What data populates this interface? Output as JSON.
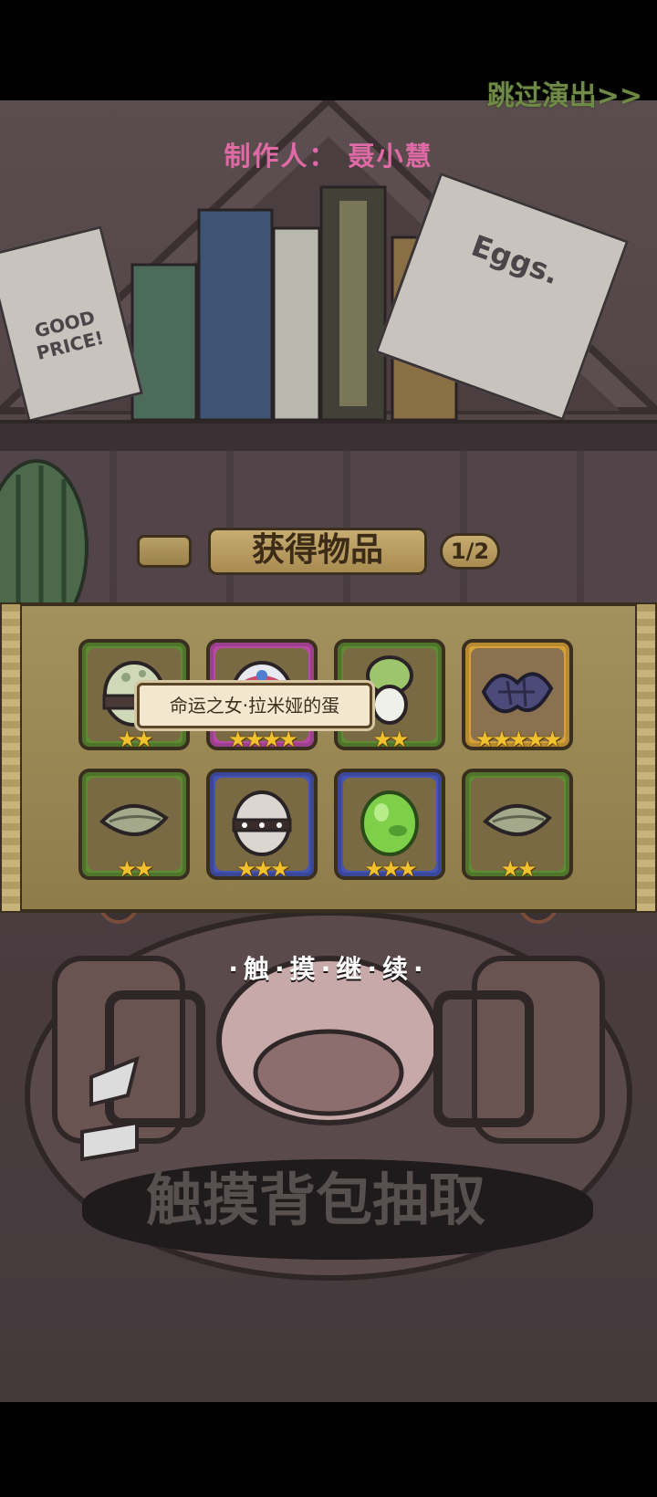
{
  "header": {
    "skip_label": "跳过演出>>",
    "credit": "制作人：  聂小慧"
  },
  "result_panel": {
    "title": "获得物品",
    "page": "1/2",
    "tooltip": "命运之女·拉米娅的蛋",
    "items": [
      {
        "name": "striped-egg",
        "stars": "★★",
        "rarity": 2
      },
      {
        "name": "lamia-egg",
        "stars": "★★★★",
        "rarity": 4
      },
      {
        "name": "radish",
        "stars": "★★",
        "rarity": 2
      },
      {
        "name": "dark-feather",
        "stars": "★★★★★",
        "rarity": 5
      },
      {
        "name": "leaf-seed",
        "stars": "★★",
        "rarity": 2
      },
      {
        "name": "studded-egg",
        "stars": "★★★",
        "rarity": 3
      },
      {
        "name": "green-slime-egg",
        "stars": "★★★",
        "rarity": 3
      },
      {
        "name": "leaf-seed",
        "stars": "★★",
        "rarity": 2
      }
    ]
  },
  "hints": {
    "continue": "·触·摸·继·续·",
    "draw": "触摸背包抽取"
  },
  "background_notes": {
    "good_price": "GOOD PRICE!",
    "eggs_sign": "Eggs."
  },
  "colors": {
    "credit": "#e06aa6",
    "skip": "#6f8a46",
    "rarity2": "#5d8a33",
    "rarity3": "#4554b4",
    "rarity4": "#b84aa6",
    "rarity5": "#d7a13a"
  }
}
